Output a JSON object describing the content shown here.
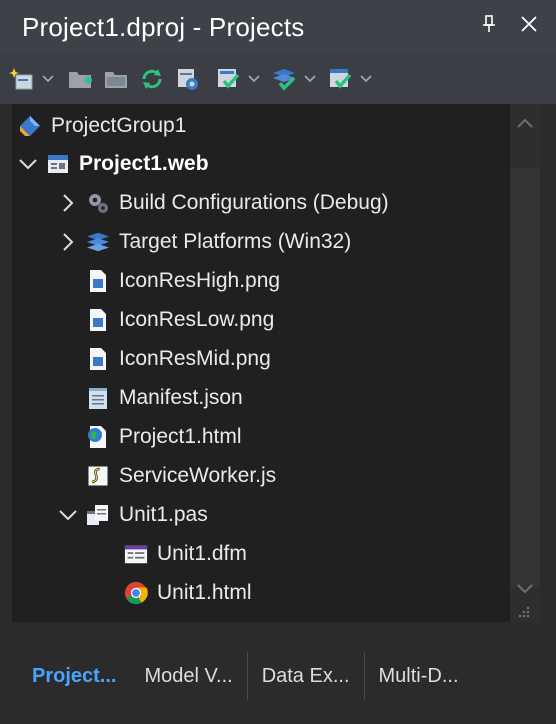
{
  "window": {
    "title": "Project1.dproj - Projects"
  },
  "toolbar": {
    "buttons": [
      {
        "name": "new-item"
      },
      {
        "name": "add-new"
      },
      {
        "name": "open"
      },
      {
        "name": "sync"
      },
      {
        "name": "build"
      },
      {
        "name": "build-all"
      },
      {
        "name": "layers"
      },
      {
        "name": "deploy"
      }
    ]
  },
  "tree": {
    "items": [
      {
        "label": "ProjectGroup1"
      },
      {
        "label": "Project1.web"
      },
      {
        "label": "Build Configurations (Debug)"
      },
      {
        "label": "Target Platforms (Win32)"
      },
      {
        "label": "IconResHigh.png"
      },
      {
        "label": "IconResLow.png"
      },
      {
        "label": "IconResMid.png"
      },
      {
        "label": "Manifest.json"
      },
      {
        "label": "Project1.html"
      },
      {
        "label": "ServiceWorker.js"
      },
      {
        "label": "Unit1.pas"
      },
      {
        "label": "Unit1.dfm"
      },
      {
        "label": "Unit1.html"
      }
    ]
  },
  "tabs": [
    {
      "label": "Project..."
    },
    {
      "label": "Model V..."
    },
    {
      "label": "Data Ex..."
    },
    {
      "label": "Multi-D..."
    }
  ],
  "colors": {
    "accent": "#4aa3ff",
    "titlebar": "#3d4248",
    "toolbar": "#3b3f45",
    "tree_bg": "#202020"
  }
}
